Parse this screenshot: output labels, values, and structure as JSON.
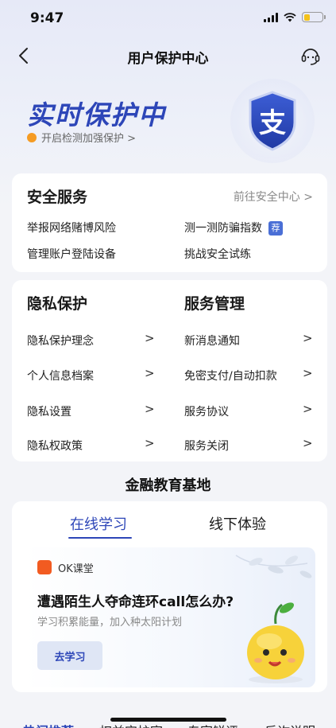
{
  "status_bar": {
    "time": "9:47"
  },
  "nav": {
    "title": "用户保护中心"
  },
  "hero": {
    "title": "实时保护中",
    "subtitle": "开启检测加强保护 >",
    "shield_glyph": "支",
    "brand_color": "#2d46b8"
  },
  "security": {
    "title": "安全服务",
    "link": "前往安全中心 >",
    "items": [
      {
        "label": "举报网络赌博风险"
      },
      {
        "label": "测一测防骗指数",
        "tag": "荐"
      },
      {
        "label": "管理账户登陆设备"
      },
      {
        "label": "挑战安全试练"
      }
    ]
  },
  "privacy": {
    "title": "隐私保护",
    "items": [
      "隐私保护理念",
      "个人信息档案",
      "隐私设置",
      "隐私权政策"
    ]
  },
  "service": {
    "title": "服务管理",
    "items": [
      "新消息通知",
      "免密支付/自动扣款",
      "服务协议",
      "服务关闭"
    ]
  },
  "education": {
    "title": "金融教育基地",
    "tabs": [
      "在线学习",
      "线下体验"
    ],
    "active_tab": 0,
    "course": {
      "brand": "OK课堂",
      "title": "遭遇陌生人夺命连环call怎么办?",
      "subtitle": "学习积累能量，加入种太阳计划",
      "button": "去学习"
    }
  },
  "bottom_tabs": [
    "热门推荐",
    "权益守护官",
    "专家锐评",
    "反诈说明"
  ],
  "icons": {
    "back": "chevron-left-icon",
    "support": "headset-icon",
    "shield": "shield-icon",
    "chevron": "chevron-right-icon"
  }
}
